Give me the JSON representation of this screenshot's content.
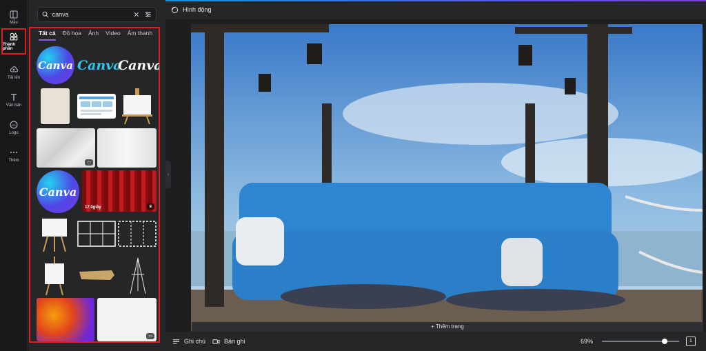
{
  "rail": {
    "items": [
      {
        "label": "Mẫu"
      },
      {
        "label": "Thành phần"
      },
      {
        "label": "Tải lên"
      },
      {
        "label": "Văn bản"
      },
      {
        "label": "Logo"
      },
      {
        "label": "Thêm"
      }
    ]
  },
  "search": {
    "value": "canva",
    "placeholder": ""
  },
  "tabs": [
    "Tất cả",
    "Đồ họa",
    "Ảnh",
    "Video",
    "Âm thanh"
  ],
  "results": {
    "logo_text": "Canva",
    "wordmark_1": "Canva",
    "wordmark_2": "Canva",
    "video_duration": "17.0giây"
  },
  "topbar": {
    "title": "Hình động"
  },
  "canvas": {
    "add_page": "+ Thêm trang"
  },
  "bottombar": {
    "notes": "Ghi chú",
    "record": "Bản ghi",
    "zoom": "69%",
    "zoom_level": 0.69,
    "page_count": "1"
  },
  "colors": {
    "accent": "#8b5cf6",
    "highlight": "#e21c21"
  }
}
